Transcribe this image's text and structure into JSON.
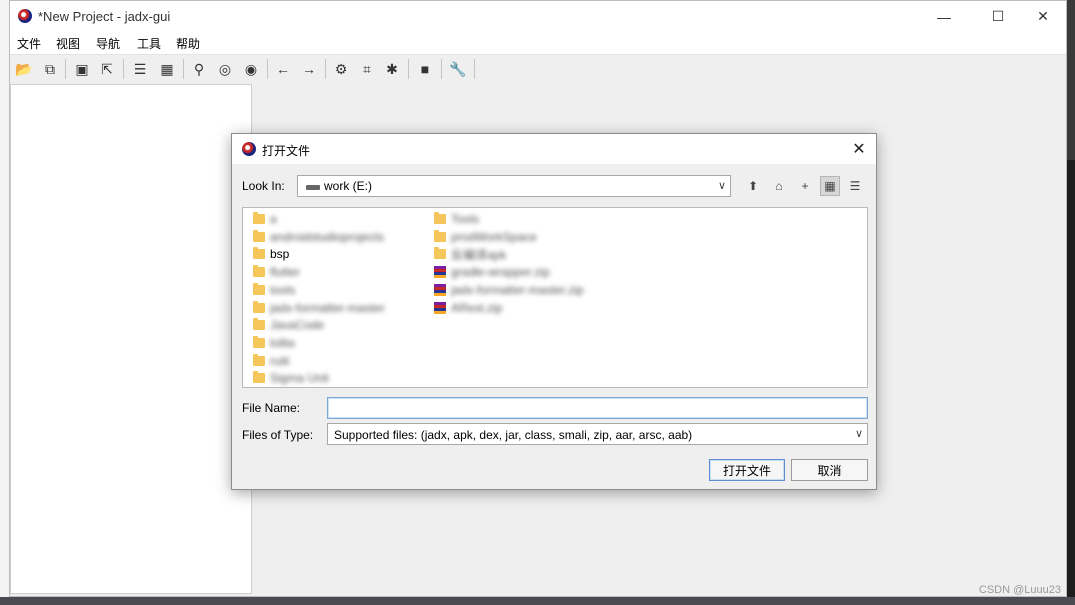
{
  "window": {
    "title": "*New Project - jadx-gui",
    "controls": {
      "minimize": "—",
      "maximize": "☐",
      "close": "✕"
    }
  },
  "menu": {
    "items": [
      {
        "label": "文件"
      },
      {
        "label": "视图"
      },
      {
        "label": "导航"
      },
      {
        "label": "工具"
      },
      {
        "label": "帮助"
      }
    ]
  },
  "toolbar": {
    "buttons": [
      {
        "name": "open-icon",
        "glyph": "📂"
      },
      {
        "name": "add-files-icon",
        "glyph": "⧉"
      },
      {
        "name": "save-icon",
        "glyph": "▣"
      },
      {
        "name": "export-icon",
        "glyph": "⇱"
      },
      {
        "name": "sync-icon",
        "glyph": "☰"
      },
      {
        "name": "flatten-icon",
        "glyph": "▦"
      },
      {
        "name": "search-icon",
        "glyph": "⚲"
      },
      {
        "name": "find-class-icon",
        "glyph": "◎"
      },
      {
        "name": "find-usage-icon",
        "glyph": "◉"
      },
      {
        "name": "back-icon",
        "glyph": "←"
      },
      {
        "name": "forward-icon",
        "glyph": "→"
      },
      {
        "name": "deobfuscation-icon",
        "glyph": "⚙"
      },
      {
        "name": "quark-icon",
        "glyph": "⌗"
      },
      {
        "name": "debug-icon",
        "glyph": "✱"
      },
      {
        "name": "log-icon",
        "glyph": "■"
      },
      {
        "name": "preferences-icon",
        "glyph": "🔧"
      }
    ]
  },
  "dialog": {
    "title": "打开文件",
    "close": "✕",
    "look_in_label": "Look In:",
    "look_in_value": "work (E:)",
    "nav_buttons": [
      {
        "name": "up-folder-icon",
        "glyph": "⬆"
      },
      {
        "name": "home-icon",
        "glyph": "⌂"
      },
      {
        "name": "new-folder-icon",
        "glyph": "+"
      },
      {
        "name": "list-view-icon",
        "glyph": "▦"
      },
      {
        "name": "details-view-icon",
        "glyph": "☰"
      }
    ],
    "files_col1": [
      {
        "type": "folder",
        "name": "a",
        "blurred": true
      },
      {
        "type": "folder",
        "name": "androidstudioprojects",
        "blurred": true
      },
      {
        "type": "folder",
        "name": "bsp",
        "blurred": false
      },
      {
        "type": "folder",
        "name": "flutter",
        "blurred": true
      },
      {
        "type": "folder",
        "name": "tools",
        "blurred": true
      },
      {
        "type": "folder",
        "name": "jadx-formatter-master",
        "blurred": true
      },
      {
        "type": "folder",
        "name": "JavaCode",
        "blurred": true
      },
      {
        "type": "folder",
        "name": "lolita",
        "blurred": true
      },
      {
        "type": "folder",
        "name": "ruiti",
        "blurred": true
      },
      {
        "type": "folder",
        "name": "Sigma Unit",
        "blurred": true
      }
    ],
    "files_col2": [
      {
        "type": "folder",
        "name": "Tools",
        "blurred": true
      },
      {
        "type": "folder",
        "name": "prodWorkSpace",
        "blurred": true
      },
      {
        "type": "folder",
        "name": "反编译apk",
        "blurred": true
      },
      {
        "type": "archive",
        "name": "gradle-wrapper.zip",
        "blurred": true
      },
      {
        "type": "archive",
        "name": "jadx-formatter-master.zip",
        "blurred": true
      },
      {
        "type": "archive",
        "name": "ARest.zip",
        "blurred": true
      }
    ],
    "file_name_label": "File Name:",
    "file_name_value": "",
    "file_type_label": "Files of Type:",
    "file_type_value": "Supported files: (jadx, apk, dex, jar, class, smali, zip, aar, arsc, aab)",
    "open_button": "打开文件",
    "cancel_button": "取消"
  },
  "watermark": "CSDN @Luuu23",
  "colors": {
    "folder": "#f5c65a",
    "focus": "#7aa7d6"
  }
}
